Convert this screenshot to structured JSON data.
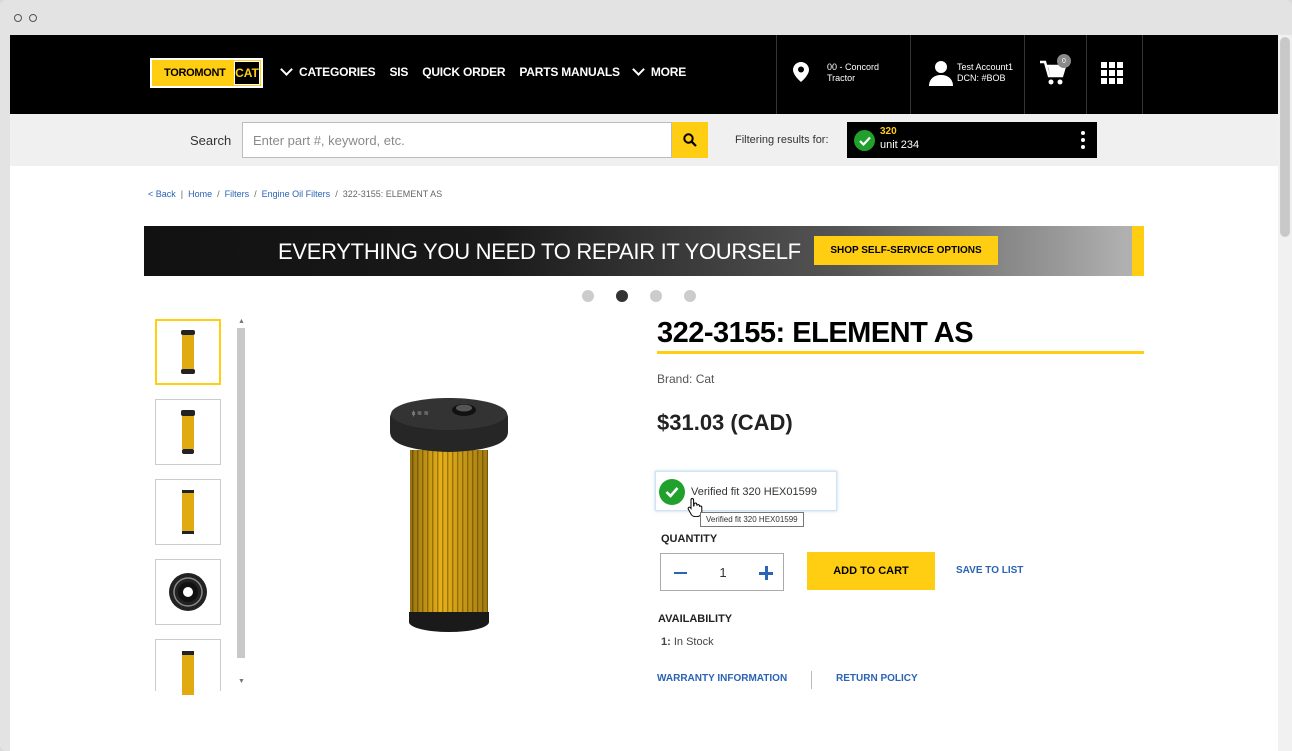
{
  "nav": {
    "logo_text": "TOROMONT",
    "logo_badge": "CAT",
    "categories": "CATEGORIES",
    "sis": "SIS",
    "quick_order": "QUICK ORDER",
    "parts_manuals": "PARTS MANUALS",
    "more": "MORE",
    "location_line1": "00 - Concord",
    "location_line2": "Tractor",
    "account_name": "Test Account1",
    "account_dcn": "DCN: #BOB",
    "cart_count": "0"
  },
  "search": {
    "label": "Search",
    "placeholder": "Enter part #, keyword, etc."
  },
  "filter": {
    "label": "Filtering results for:",
    "model": "320",
    "unit": "unit 234"
  },
  "breadcrumb": {
    "back": "< Back",
    "sep": "|",
    "home": "Home",
    "filters": "Filters",
    "engine_oil_filters": "Engine Oil Filters",
    "current": "322-3155: ELEMENT AS",
    "slash": "/"
  },
  "banner": {
    "text": "EVERYTHING YOU NEED TO REPAIR IT YOURSELF",
    "button": "SHOP SELF-SERVICE OPTIONS",
    "active_slide": 2,
    "slide_count": 4
  },
  "product": {
    "title": "322-3155: ELEMENT AS",
    "brand": "Brand: Cat",
    "price": "$31.03 (CAD)",
    "verified": "Verified fit 320 HEX01599",
    "tooltip": "Verified fit 320 HEX01599",
    "quantity_label": "QUANTITY",
    "quantity": "1",
    "add_to_cart": "ADD TO CART",
    "save_to_list": "SAVE TO LIST",
    "availability_label": "AVAILABILITY",
    "availability_qty": "1:",
    "availability_status": "In Stock",
    "warranty": "WARRANTY INFORMATION",
    "return_policy": "RETURN POLICY"
  },
  "colors": {
    "brand_yellow": "#ffcd11",
    "link_blue": "#2b63b5",
    "check_green": "#21a12c"
  }
}
